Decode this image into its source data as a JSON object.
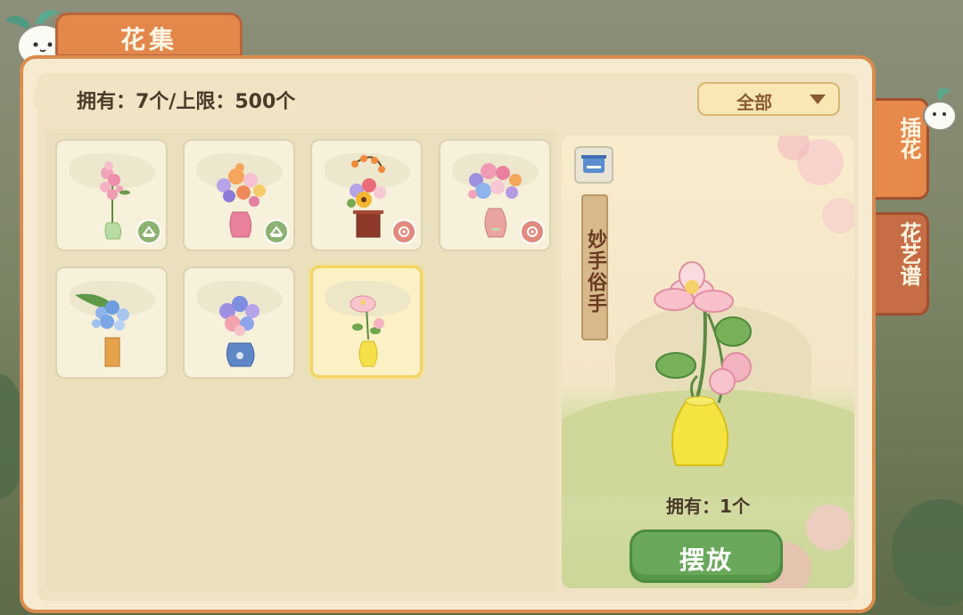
{
  "header": {
    "title": "花集"
  },
  "info": {
    "owned_text": "拥有：7个/上限：500个"
  },
  "filter": {
    "selected": "全部"
  },
  "grid": {
    "items": [
      {
        "name": "pink-lilac-bouquet",
        "badge": "green"
      },
      {
        "name": "mixed-bouquet",
        "badge": "green"
      },
      {
        "name": "lantern-sunflower-bouquet",
        "badge": "red"
      },
      {
        "name": "rose-hydrangea-bouquet",
        "badge": "red"
      },
      {
        "name": "blue-leaf-bouquet",
        "badge": "none"
      },
      {
        "name": "hydrangea-blue-vase",
        "badge": "none"
      },
      {
        "name": "lotus-yellow-vase",
        "badge": "none",
        "selected": true
      }
    ]
  },
  "preview": {
    "title": "妙手俗手",
    "owned": "拥有：1个",
    "place_button": "摆放"
  },
  "side_tabs": {
    "arrange": "插花",
    "book": "花艺谱"
  },
  "colors": {
    "accent": "#e3874b",
    "button": "#69a85a",
    "panel": "#f6ead0"
  }
}
